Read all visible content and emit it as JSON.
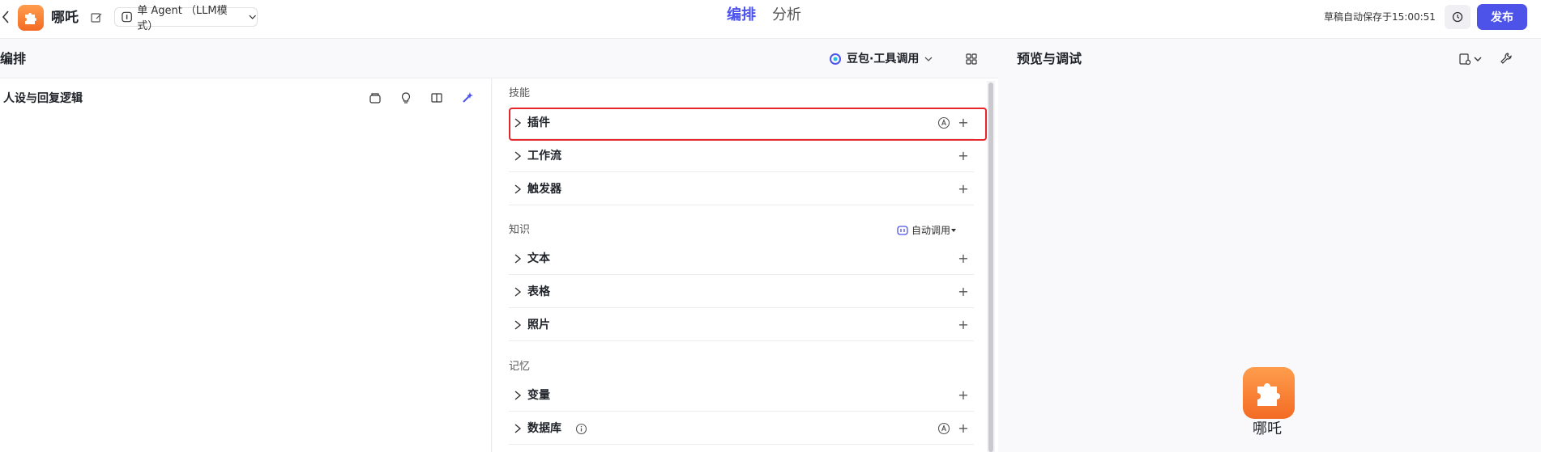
{
  "header": {
    "app_name": "哪吒",
    "mode": "单 Agent （LLM模式）",
    "tabs": [
      {
        "label": "编排",
        "active": true
      },
      {
        "label": "分析",
        "active": false
      }
    ],
    "save_status": "草稿自动保存于15:00:51",
    "publish_label": "发布"
  },
  "orchestration": {
    "title": "编排",
    "model": "豆包·工具调用"
  },
  "prompt": {
    "title": "人设与回复逻辑"
  },
  "skills": {
    "title": "技能",
    "items": [
      {
        "label": "插件"
      },
      {
        "label": "工作流"
      },
      {
        "label": "触发器"
      }
    ]
  },
  "knowledge": {
    "title": "知识",
    "auto_call": "自动调用",
    "items": [
      {
        "label": "文本"
      },
      {
        "label": "表格"
      },
      {
        "label": "照片"
      }
    ]
  },
  "memory": {
    "title": "记忆",
    "items": [
      {
        "label": "变量"
      },
      {
        "label": "数据库"
      }
    ]
  },
  "preview": {
    "title": "预览与调试",
    "bot_name": "哪吒"
  },
  "colors": {
    "accent": "#4d53e8",
    "highlight": "#e5262a",
    "logo": "#f36b24"
  },
  "icons": {
    "add": "+"
  }
}
